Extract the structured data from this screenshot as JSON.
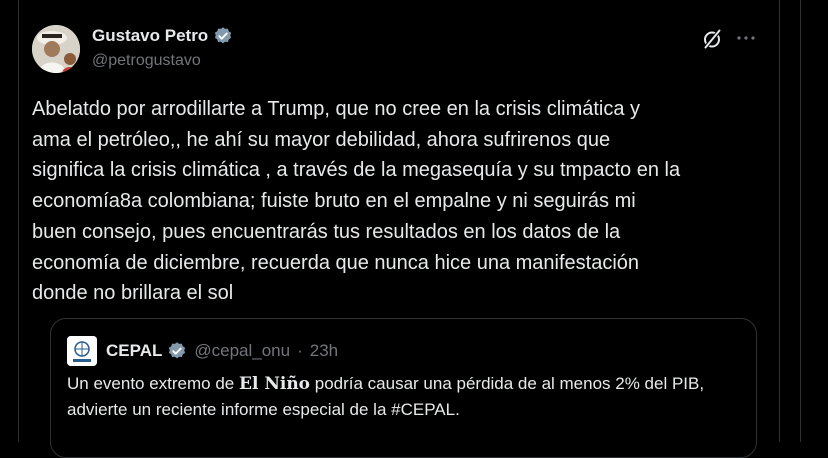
{
  "author": {
    "display_name": "Gustavo Petro",
    "handle": "@petrogustavo"
  },
  "post": {
    "text": "Abelatdo por arrodillarte a Trump, que no cree en la crisis climática y\nama el petróleo,, he ahí su mayor  debilidad, ahora sufrirenos que\nsignifica la crisis climática , a través de la megasequía y su tmpacto en la\neconomía8a colombiana;  fuiste bruto en el empalne y ni seguirás mi\nbuen consejo, pues encuentrarás tus resultados en los datos de la\neconomía de diciembre, recuerda que nunca hice una manifestación\ndonde no brillara el sol"
  },
  "quoted": {
    "display_name": "CEPAL",
    "handle": "@cepal_onu",
    "separator": "·",
    "time": "23h",
    "text_before": "Un evento extremo de ",
    "text_bold": "El Niño",
    "text_after": " podría causar una pérdida de al menos 2% del PIB, advierte un reciente informe especial de la #CEPAL."
  },
  "icons": {
    "verified": "verified-badge-icon",
    "grok": "grok-icon",
    "more": "more-horizontal-icon"
  },
  "colors": {
    "background": "#000000",
    "text": "#e7e9ea",
    "secondary": "#71767b",
    "verified": "#829aab",
    "border": "#2f3336"
  }
}
